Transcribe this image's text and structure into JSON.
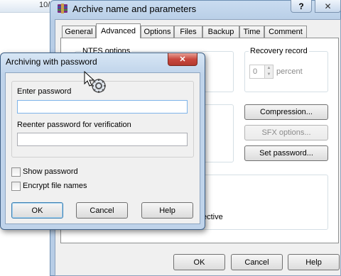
{
  "background": {
    "peek_text": "10/",
    "accent": "#cfe0f3"
  },
  "main_window": {
    "title": "Archive name and parameters",
    "help_glyph": "?",
    "close_glyph": "✕",
    "tabs": [
      {
        "label": "General"
      },
      {
        "label": "Advanced"
      },
      {
        "label": "Options"
      },
      {
        "label": "Files"
      },
      {
        "label": "Backup"
      },
      {
        "label": "Time"
      },
      {
        "label": "Comment"
      }
    ],
    "active_tab": "Advanced",
    "ntfs_label": "NTFS options",
    "recovery": {
      "label": "Recovery record",
      "value": "0",
      "unit": "percent"
    },
    "buttons": {
      "compression": "Compression...",
      "sfx": "SFX options...",
      "set_password": "Set password..."
    },
    "partial_text": "ective",
    "footer": {
      "ok": "OK",
      "cancel": "Cancel",
      "help": "Help"
    }
  },
  "password_dialog": {
    "title": "Archiving with password",
    "close_glyph": "✕",
    "enter_label": "Enter password",
    "enter_value": "",
    "reenter_label": "Reenter password for verification",
    "reenter_value": "",
    "show_password": {
      "label": "Show password",
      "checked": false
    },
    "encrypt_names": {
      "label": "Encrypt file names",
      "checked": false
    },
    "buttons": {
      "ok": "OK",
      "cancel": "Cancel",
      "help": "Help"
    }
  },
  "colors": {
    "titlebar_glass": "#bcd3ec",
    "close_red": "#c9483e",
    "default_button_border": "#3c7fb1"
  },
  "icons": {
    "app": "winrar-icon",
    "cursor": "busy-cursor-icon"
  }
}
